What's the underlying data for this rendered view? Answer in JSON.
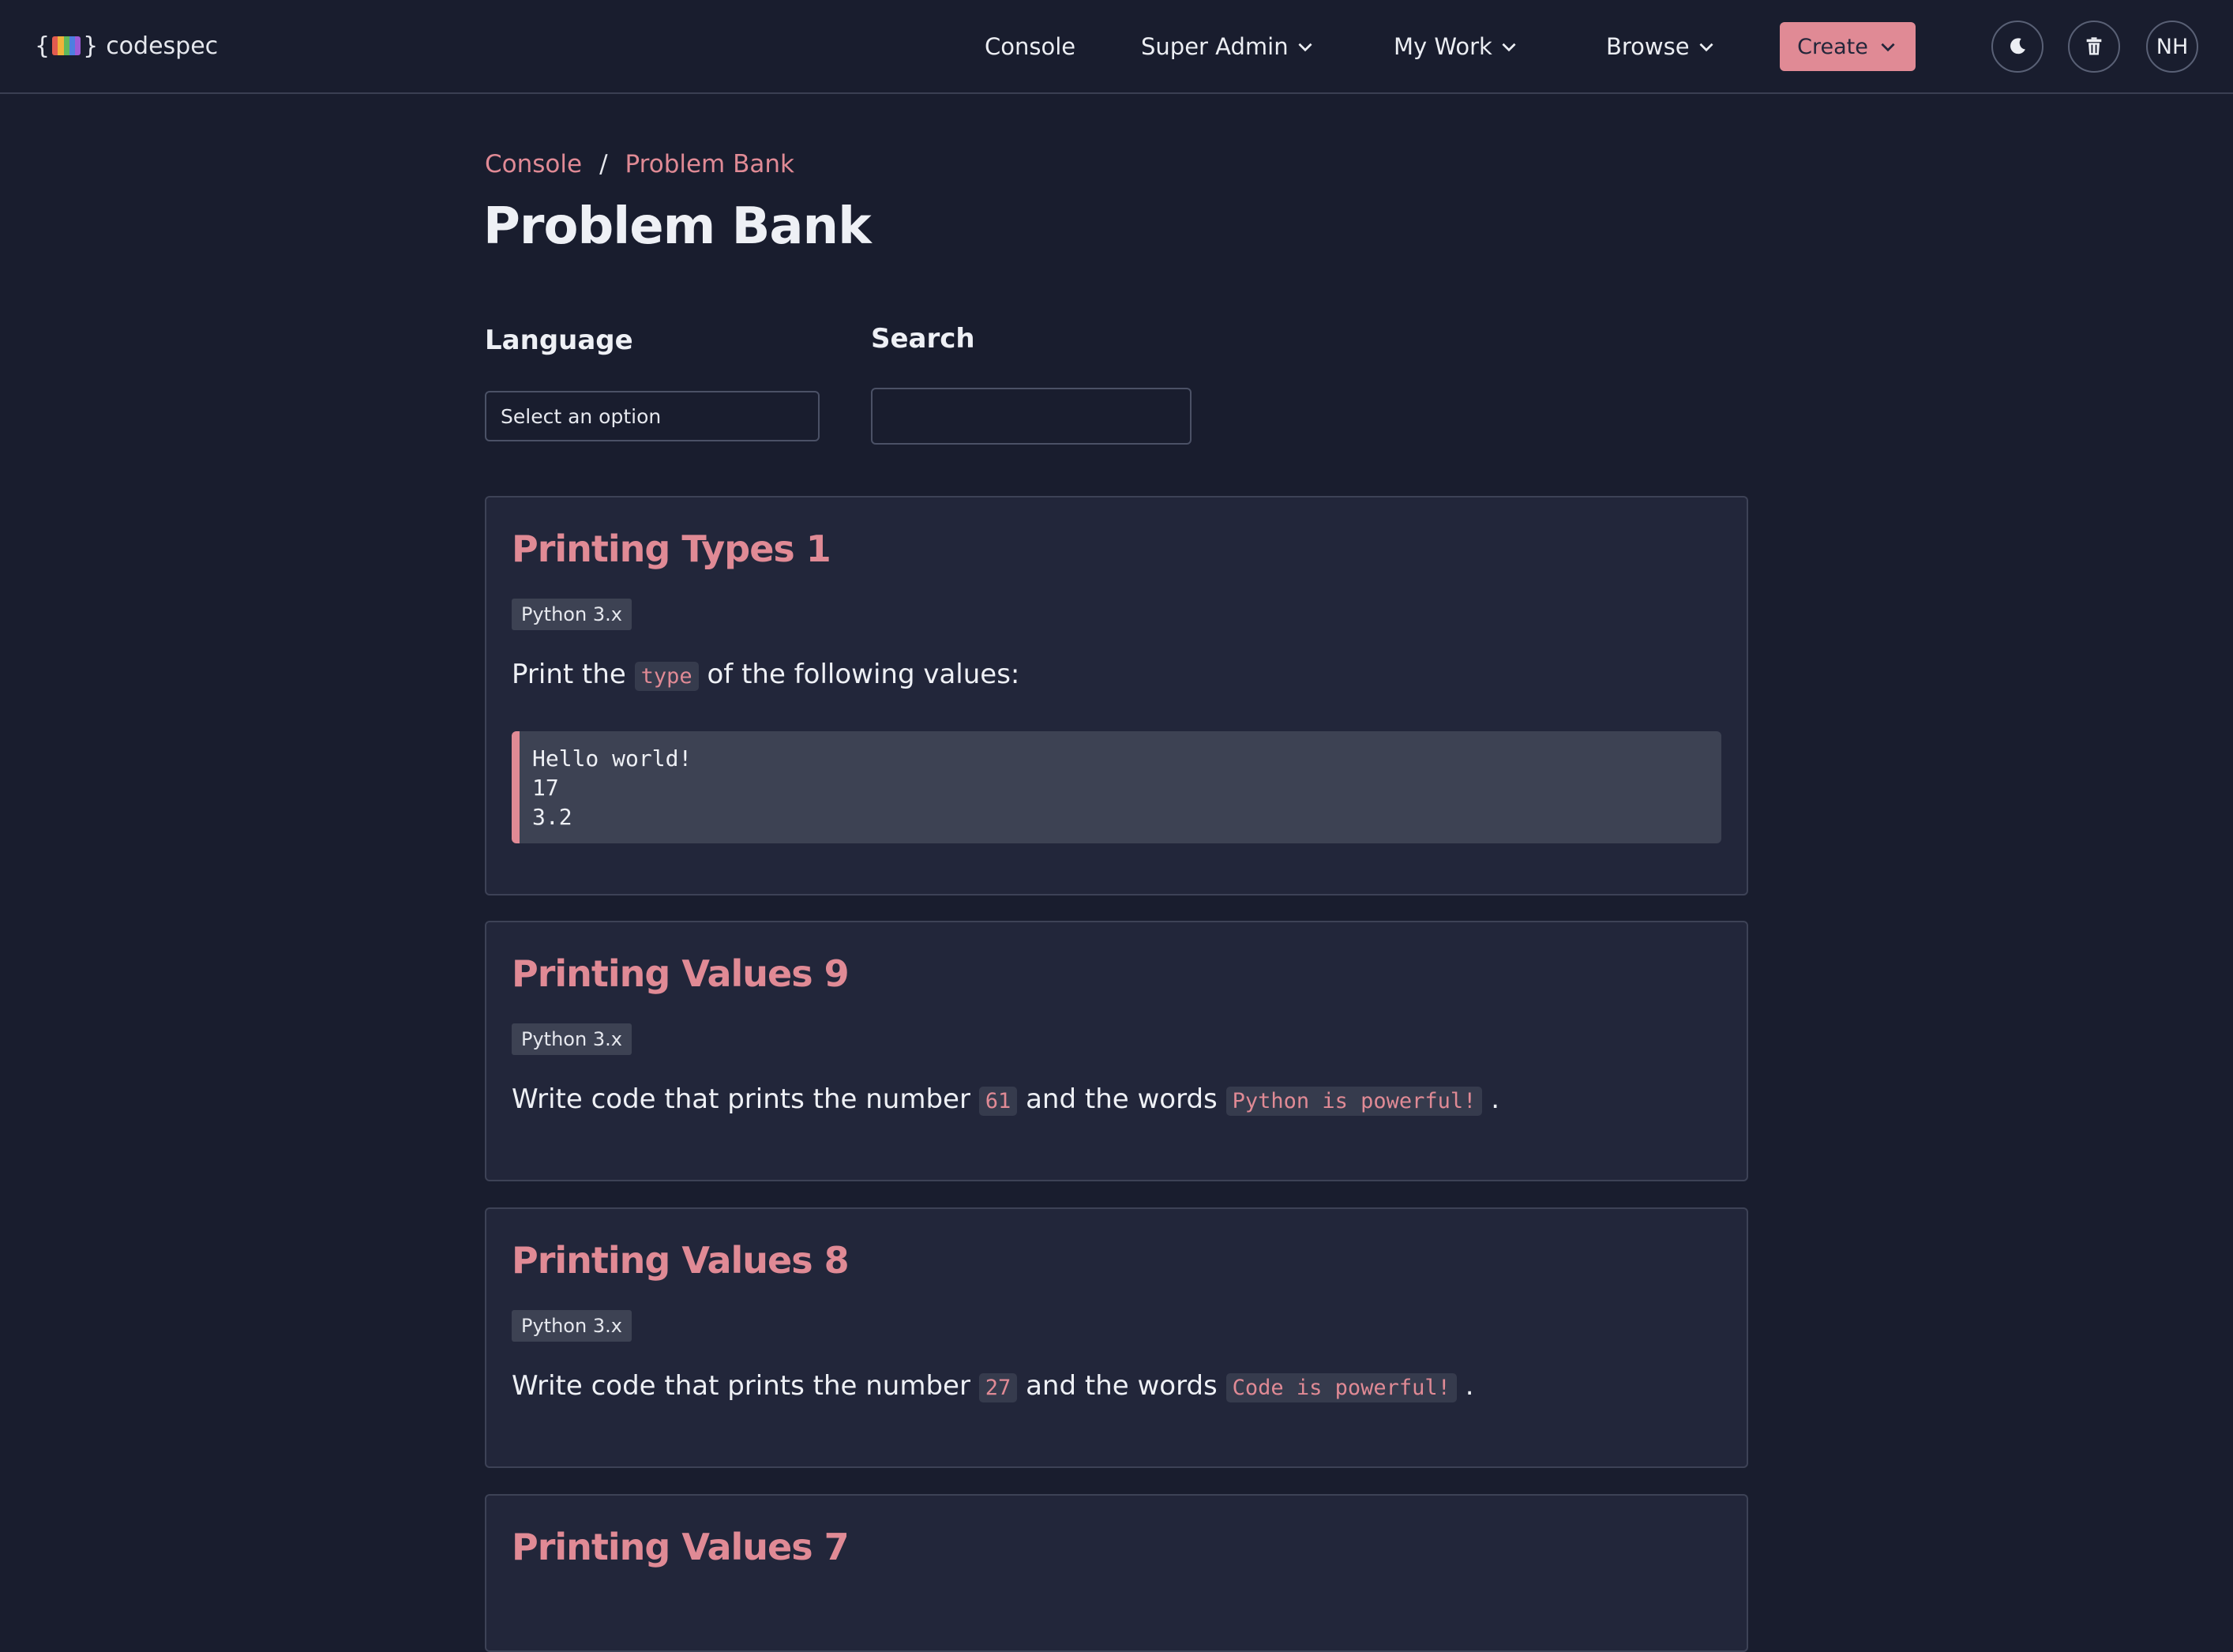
{
  "brand": {
    "name": "codespec",
    "brace_open": "{",
    "brace_close": "}",
    "colors": [
      "#e35b4f",
      "#f0b23a",
      "#5fb85c",
      "#4d7fe0",
      "#9c5bd6"
    ]
  },
  "nav": {
    "console": "Console",
    "super_admin": "Super Admin",
    "my_work": "My Work",
    "browse": "Browse",
    "create": "Create",
    "theme_icon": "moon-icon",
    "trash_icon": "trash-icon",
    "avatar_initials": "NH"
  },
  "breadcrumb": {
    "items": [
      "Console",
      "Problem Bank"
    ],
    "separator": "/"
  },
  "page": {
    "title": "Problem Bank"
  },
  "filters": {
    "language_label": "Language",
    "language_value": "Select an option",
    "search_label": "Search",
    "search_value": ""
  },
  "problems": [
    {
      "title": "Printing Types 1",
      "language": "Python 3.x",
      "desc_before": "Print the",
      "code1": "type",
      "desc_middle": "of the following values:",
      "code_block": "Hello world!\n17\n3.2"
    },
    {
      "title": "Printing Values 9",
      "language": "Python 3.x",
      "desc_before": "Write code that prints the number",
      "code1": "61",
      "desc_middle": "and the words",
      "code2": "Python is powerful!",
      "desc_after": "."
    },
    {
      "title": "Printing Values 8",
      "language": "Python 3.x",
      "desc_before": "Write code that prints the number",
      "code1": "27",
      "desc_middle": "and the words",
      "code2": "Code is powerful!",
      "desc_after": "."
    },
    {
      "title": "Printing Values 7"
    }
  ],
  "colors": {
    "background": "#191d2e",
    "card": "#22263a",
    "accent": "#e08a95",
    "text": "#eef0f5"
  }
}
